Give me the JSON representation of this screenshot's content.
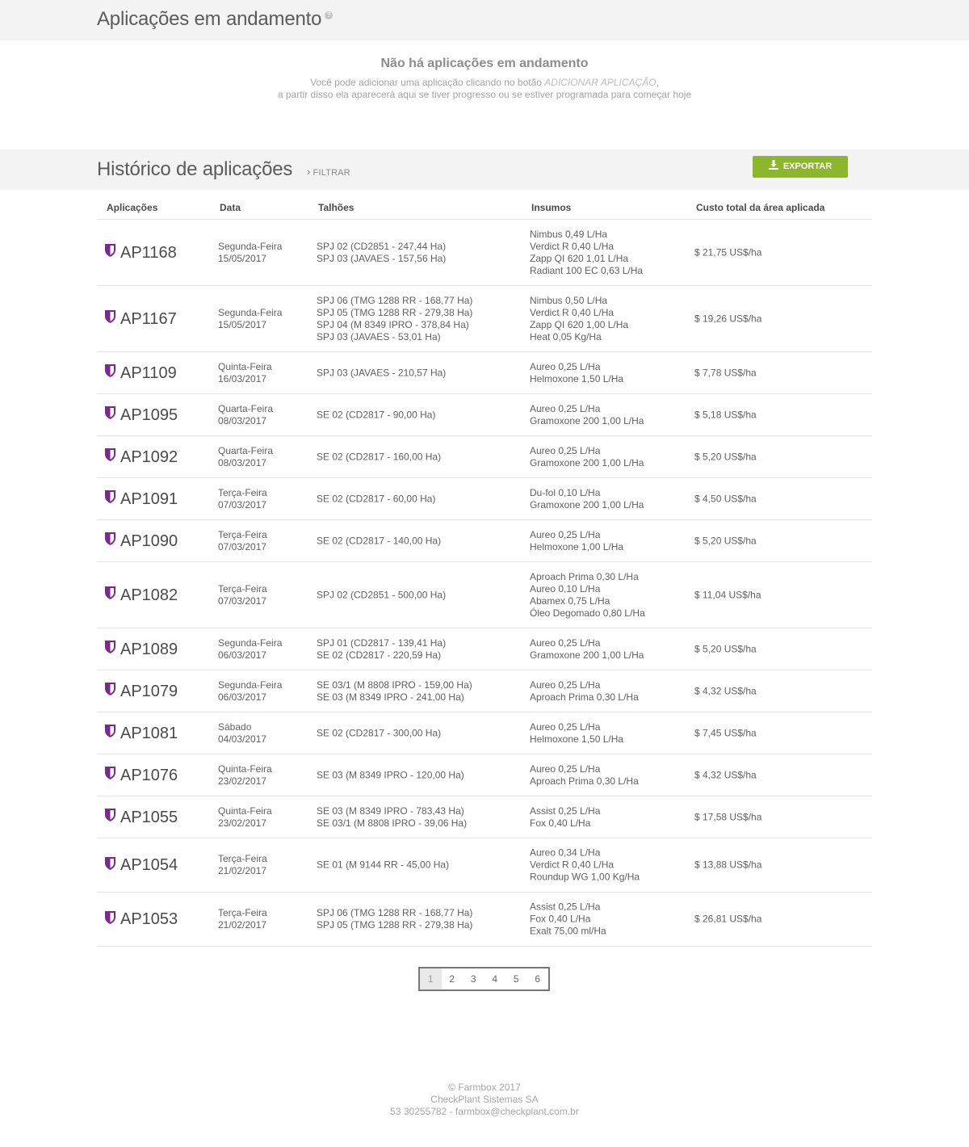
{
  "ongoing": {
    "title": "Aplicações em andamento",
    "help_icon": "?",
    "empty_title": "Não há aplicações em andamento",
    "empty_line1_before": "Você pode adicionar uma aplicação clicando no botão ",
    "empty_line1_link": "ADICIONAR APLICAÇÃO",
    "empty_line1_after": ",",
    "empty_line2": "a partir disso ela aparecerá aqui se tiver progresso ou se estiver programada para começar hoje"
  },
  "history": {
    "title": "Histórico de aplicações",
    "filter_label": "FILTRAR",
    "export_label": "EXPORTAR"
  },
  "colors": {
    "accent": "#8cb62c",
    "shield": "#7b2a8c"
  },
  "table": {
    "headers": [
      "Aplicações",
      "Data",
      "Talhões",
      "Insumos",
      "Custo total da área aplicada"
    ],
    "rows": [
      {
        "id": "AP1168",
        "weekday": "Segunda-Feira",
        "date": "15/05/2017",
        "talhoes": [
          "SPJ 02 (CD2851 - 247,44 Ha)",
          "SPJ 03 (JAVAES - 157,56 Ha)"
        ],
        "insumos": [
          "Nimbus 0,49 L/Ha",
          "Verdict R 0,40 L/Ha",
          "Zapp QI 620 1,01 L/Ha",
          "Radiant 100 EC 0,63 L/Ha"
        ],
        "cost": "$ 21,75 US$/ha"
      },
      {
        "id": "AP1167",
        "weekday": "Segunda-Feira",
        "date": "15/05/2017",
        "talhoes": [
          "SPJ 06 (TMG 1288 RR - 168,77 Ha)",
          "SPJ 05 (TMG 1288 RR - 279,38 Ha)",
          "SPJ 04 (M 8349 IPRO - 378,84 Ha)",
          "SPJ 03 (JAVAES - 53,01 Ha)"
        ],
        "insumos": [
          "Nimbus 0,50 L/Ha",
          "Verdict R 0,40 L/Ha",
          "Zapp QI 620 1,00 L/Ha",
          "Heat 0,05 Kg/Ha"
        ],
        "cost": "$ 19,26 US$/ha"
      },
      {
        "id": "AP1109",
        "weekday": "Quinta-Feira",
        "date": "16/03/2017",
        "talhoes": [
          "SPJ 03 (JAVAES - 210,57 Ha)"
        ],
        "insumos": [
          "Aureo 0,25 L/Ha",
          "Helmoxone 1,50 L/Ha"
        ],
        "cost": "$ 7,78 US$/ha"
      },
      {
        "id": "AP1095",
        "weekday": "Quarta-Feira",
        "date": "08/03/2017",
        "talhoes": [
          "SE 02 (CD2817 - 90,00 Ha)"
        ],
        "insumos": [
          "Aureo 0,25 L/Ha",
          "Gramoxone 200 1,00 L/Ha"
        ],
        "cost": "$ 5,18 US$/ha"
      },
      {
        "id": "AP1092",
        "weekday": "Quarta-Feira",
        "date": "08/03/2017",
        "talhoes": [
          "SE 02 (CD2817 - 160,00 Ha)"
        ],
        "insumos": [
          "Aureo 0,25 L/Ha",
          "Gramoxone 200 1,00 L/Ha"
        ],
        "cost": "$ 5,20 US$/ha"
      },
      {
        "id": "AP1091",
        "weekday": "Terça-Feira",
        "date": "07/03/2017",
        "talhoes": [
          "SE 02 (CD2817 - 60,00 Ha)"
        ],
        "insumos": [
          "Du-fol 0,10 L/Ha",
          "Gramoxone 200 1,00 L/Ha"
        ],
        "cost": "$ 4,50 US$/ha"
      },
      {
        "id": "AP1090",
        "weekday": "Terça-Feira",
        "date": "07/03/2017",
        "talhoes": [
          "SE 02 (CD2817 - 140,00 Ha)"
        ],
        "insumos": [
          "Aureo 0,25 L/Ha",
          "Helmoxone 1,00 L/Ha"
        ],
        "cost": "$ 5,20 US$/ha"
      },
      {
        "id": "AP1082",
        "weekday": "Terça-Feira",
        "date": "07/03/2017",
        "talhoes": [
          "SPJ 02 (CD2851 - 500,00 Ha)"
        ],
        "insumos": [
          "Aproach Prima 0,30 L/Ha",
          "Aureo 0,10 L/Ha",
          "Abamex 0,75 L/Ha",
          "Óleo Degomado 0,80 L/Ha"
        ],
        "cost": "$ 11,04 US$/ha"
      },
      {
        "id": "AP1089",
        "weekday": "Segunda-Feira",
        "date": "06/03/2017",
        "talhoes": [
          "SPJ 01 (CD2817 - 139,41 Ha)",
          "SE 02 (CD2817 - 220,59 Ha)"
        ],
        "insumos": [
          "Aureo 0,25 L/Ha",
          "Gramoxone 200 1,00 L/Ha"
        ],
        "cost": "$ 5,20 US$/ha"
      },
      {
        "id": "AP1079",
        "weekday": "Segunda-Feira",
        "date": "06/03/2017",
        "talhoes": [
          "SE 03/1 (M 8808 IPRO - 159,00 Ha)",
          "SE 03 (M 8349 IPRO - 241,00 Ha)"
        ],
        "insumos": [
          "Aureo 0,25 L/Ha",
          "Aproach Prima 0,30 L/Ha"
        ],
        "cost": "$ 4,32 US$/ha"
      },
      {
        "id": "AP1081",
        "weekday": "Sábado",
        "date": "04/03/2017",
        "talhoes": [
          "SE 02 (CD2817 - 300,00 Ha)"
        ],
        "insumos": [
          "Aureo 0,25 L/Ha",
          "Helmoxone 1,50 L/Ha"
        ],
        "cost": "$ 7,45 US$/ha"
      },
      {
        "id": "AP1076",
        "weekday": "Quinta-Feira",
        "date": "23/02/2017",
        "talhoes": [
          "SE 03 (M 8349 IPRO - 120,00 Ha)"
        ],
        "insumos": [
          "Aureo 0,25 L/Ha",
          "Aproach Prima 0,30 L/Ha"
        ],
        "cost": "$ 4,32 US$/ha"
      },
      {
        "id": "AP1055",
        "weekday": "Quinta-Feira",
        "date": "23/02/2017",
        "talhoes": [
          "SE 03 (M 8349 IPRO - 783,43 Ha)",
          "SE 03/1 (M 8808 IPRO - 39,06 Ha)"
        ],
        "insumos": [
          "Assist 0,25 L/Ha",
          "Fox 0,40 L/Ha"
        ],
        "cost": "$ 17,58 US$/ha"
      },
      {
        "id": "AP1054",
        "weekday": "Terça-Feira",
        "date": "21/02/2017",
        "talhoes": [
          "SE 01 (M 9144 RR - 45,00 Ha)"
        ],
        "insumos": [
          "Aureo 0,34 L/Ha",
          "Verdict R 0,40 L/Ha",
          "Roundup WG 1,00 Kg/Ha"
        ],
        "cost": "$ 13,88 US$/ha"
      },
      {
        "id": "AP1053",
        "weekday": "Terça-Feira",
        "date": "21/02/2017",
        "talhoes": [
          "SPJ 06 (TMG 1288 RR - 168,77 Ha)",
          "SPJ 05 (TMG 1288 RR - 279,38 Ha)"
        ],
        "insumos": [
          "Assist 0,25 L/Ha",
          "Fox 0,40 L/Ha",
          "Exalt 75,00 ml/Ha"
        ],
        "cost": "$ 26,81 US$/ha"
      }
    ]
  },
  "pagination": {
    "pages": [
      "1",
      "2",
      "3",
      "4",
      "5",
      "6"
    ],
    "current": "1"
  },
  "footer": {
    "line1": "© Farmbox 2017",
    "line2": "CheckPlant Sistemas SA",
    "line3": "53 30255782 - farmbox@checkplant.com.br"
  }
}
